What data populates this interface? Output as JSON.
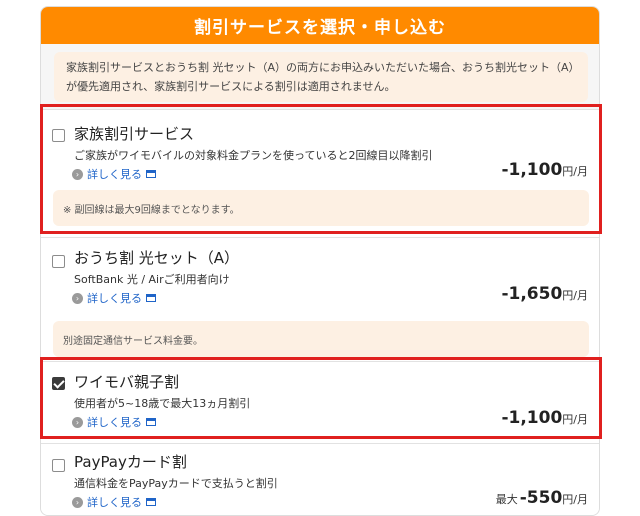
{
  "header": {
    "title": "割引サービスを選択・申し込む"
  },
  "notice": {
    "line1": "家族割引サービスとおうち割 光セット（A）の両方にお申込みいただいた場合、おうち割光セット（A）",
    "line2": "が優先適用され、家族割引サービスによる割引は適用されません。"
  },
  "items": [
    {
      "title": "家族割引サービス",
      "desc": "ご家族がワイモバイルの対象料金プランを使っていると2回線目以降割引",
      "details": "詳しく見る",
      "price": "-1,100",
      "unit": "円/月",
      "checked": false,
      "note": "※ 副回線は最大9回線までとなります。"
    },
    {
      "title": "おうち割 光セット（A）",
      "desc": "SoftBank 光 / Airご利用者向け",
      "details": "詳しく見る",
      "price": "-1,650",
      "unit": "円/月",
      "checked": false,
      "note": "別途固定通信サービス料金要。"
    },
    {
      "title": "ワイモバ親子割",
      "desc": "使用者が5~18歳で最大13ヵ月割引",
      "details": "詳しく見る",
      "price": "-1,100",
      "unit": "円/月",
      "checked": true
    },
    {
      "title": "PayPayカード割",
      "desc": "通信料金をPayPayカードで支払うと割引",
      "details": "詳しく見る",
      "prefix": "最大",
      "price": "-550",
      "unit": "円/月",
      "checked": false
    }
  ],
  "colors": {
    "header": "#ff8a00",
    "highlight": "#e0201f",
    "link": "#1f64c8"
  }
}
